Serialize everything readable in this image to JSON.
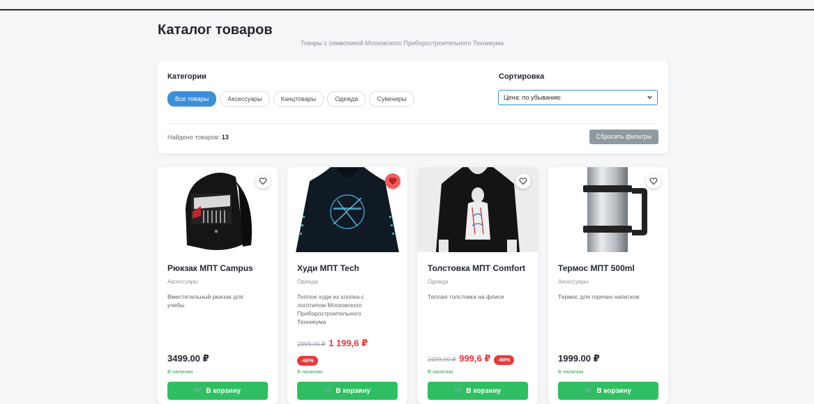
{
  "header": {
    "title": "Каталог товаров",
    "subtitle": "Товары с символикой Московского Приборостроительного Техникума"
  },
  "filters": {
    "categories_label": "Категории",
    "categories": [
      "Все товары",
      "Аксессуары",
      "Канцтовары",
      "Одежда",
      "Сувениры"
    ],
    "active_category": "Все товары",
    "sort_label": "Сортировка",
    "sort_value": "Цена: по убыванию",
    "found_label": "Найдено товаров:",
    "found_count": "13",
    "reset_label": "Сбросить фильтры"
  },
  "products": [
    {
      "name": "Рюкзак МПТ Campus",
      "category": "Аксессуары",
      "description": "Вместительный рюкзак для учебы",
      "price": "3499.00 ₽",
      "stock": "В наличии",
      "cart_label": "В корзину",
      "favorite": false
    },
    {
      "name": "Худи МПТ Tech",
      "category": "Одежда",
      "description": "Теплое худи из хлопка с логотипом Московского Приборостроительного Техникума",
      "old_price": "2999.00 ₽",
      "new_price": "1 199,6 ₽",
      "discount": "-60%",
      "stock": "В наличии",
      "cart_label": "В корзину",
      "favorite": true
    },
    {
      "name": "Толстовка МПТ Comfort",
      "category": "Одежда",
      "description": "Теплая толстовка на флисе",
      "old_price": "2499.00 ₽",
      "new_price": "999,6 ₽",
      "discount": "-60%",
      "stock": "В наличии",
      "cart_label": "В корзину",
      "favorite": false
    },
    {
      "name": "Термос МПТ 500ml",
      "category": "Аксессуары",
      "description": "Термос для горячих напитков",
      "price": "1999.00 ₽",
      "stock": "В наличии",
      "cart_label": "В корзину",
      "favorite": false
    }
  ],
  "colors": {
    "accent": "#3a8fd8",
    "cart_green": "#2fbf62",
    "sale_red": "#e53b3b",
    "stock_green": "#2f9e4f"
  }
}
